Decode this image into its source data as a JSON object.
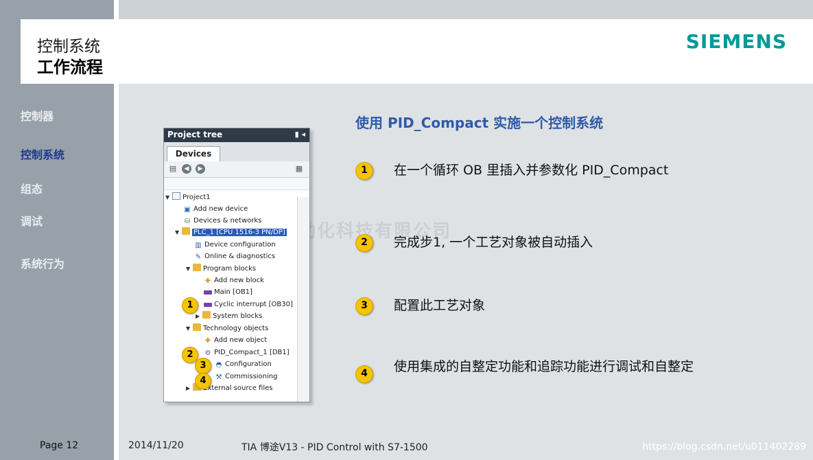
{
  "title": {
    "line1": "控制系统",
    "line2": "工作流程"
  },
  "logo": "SIEMENS",
  "sidebar": {
    "items": [
      {
        "label": "控制器",
        "active": false
      },
      {
        "label": "控制系统",
        "active": true
      },
      {
        "label": "组态",
        "active": false
      },
      {
        "label": "调试",
        "active": false
      },
      {
        "label": "系统行为",
        "active": false
      }
    ]
  },
  "main": {
    "heading": "使用 PID_Compact 实施一个控制系统",
    "steps": [
      {
        "number": "1",
        "text": "在一个循环 OB 里插入并参数化 PID_Compact"
      },
      {
        "number": "2",
        "text": "完成步1, 一个工艺对象被自动插入"
      },
      {
        "number": "3",
        "text": "配置此工艺对象"
      },
      {
        "number": "4",
        "text": "使用集成的自整定功能和追踪功能进行调试和自整定"
      }
    ]
  },
  "project_tree": {
    "header": "Project tree",
    "header_icons": "▮ ◂",
    "tab": "Devices",
    "items": [
      {
        "label": "Project1",
        "icon": "document-icon"
      },
      {
        "label": "Add new device",
        "icon": "add-device-icon"
      },
      {
        "label": "Devices & networks",
        "icon": "network-icon"
      },
      {
        "label": "PLC_1 [CPU 1516-3 PN/DP]",
        "icon": "folder-icon",
        "selected": true
      },
      {
        "label": "Device configuration",
        "icon": "device-config-icon"
      },
      {
        "label": "Online & diagnostics",
        "icon": "diagnostics-icon"
      },
      {
        "label": "Program blocks",
        "icon": "folder-icon"
      },
      {
        "label": "Add new block",
        "icon": "add-block-icon"
      },
      {
        "label": "Main [OB1]",
        "icon": "ob-block-icon"
      },
      {
        "label": "Cyclic interrupt [OB30]",
        "icon": "ob-block-icon"
      },
      {
        "label": "System blocks",
        "icon": "folder-icon"
      },
      {
        "label": "Technology objects",
        "icon": "folder-icon"
      },
      {
        "label": "Add new object",
        "icon": "add-object-icon"
      },
      {
        "label": "PID_Compact_1 [DB1]",
        "icon": "pid-icon"
      },
      {
        "label": "Configuration",
        "icon": "config-icon"
      },
      {
        "label": "Commissioning",
        "icon": "commissioning-icon"
      },
      {
        "label": "External source files",
        "icon": "folder-icon"
      }
    ],
    "badges": [
      "1",
      "2",
      "3",
      "4"
    ]
  },
  "watermark_cn": "宏盛自动化科技有限公司",
  "footer": {
    "page": "Page 12",
    "date": "2014/11/20",
    "title": "TIA 博途V13 - PID Control with S7-1500",
    "url": "https://blog.csdn.net/u011402289"
  }
}
